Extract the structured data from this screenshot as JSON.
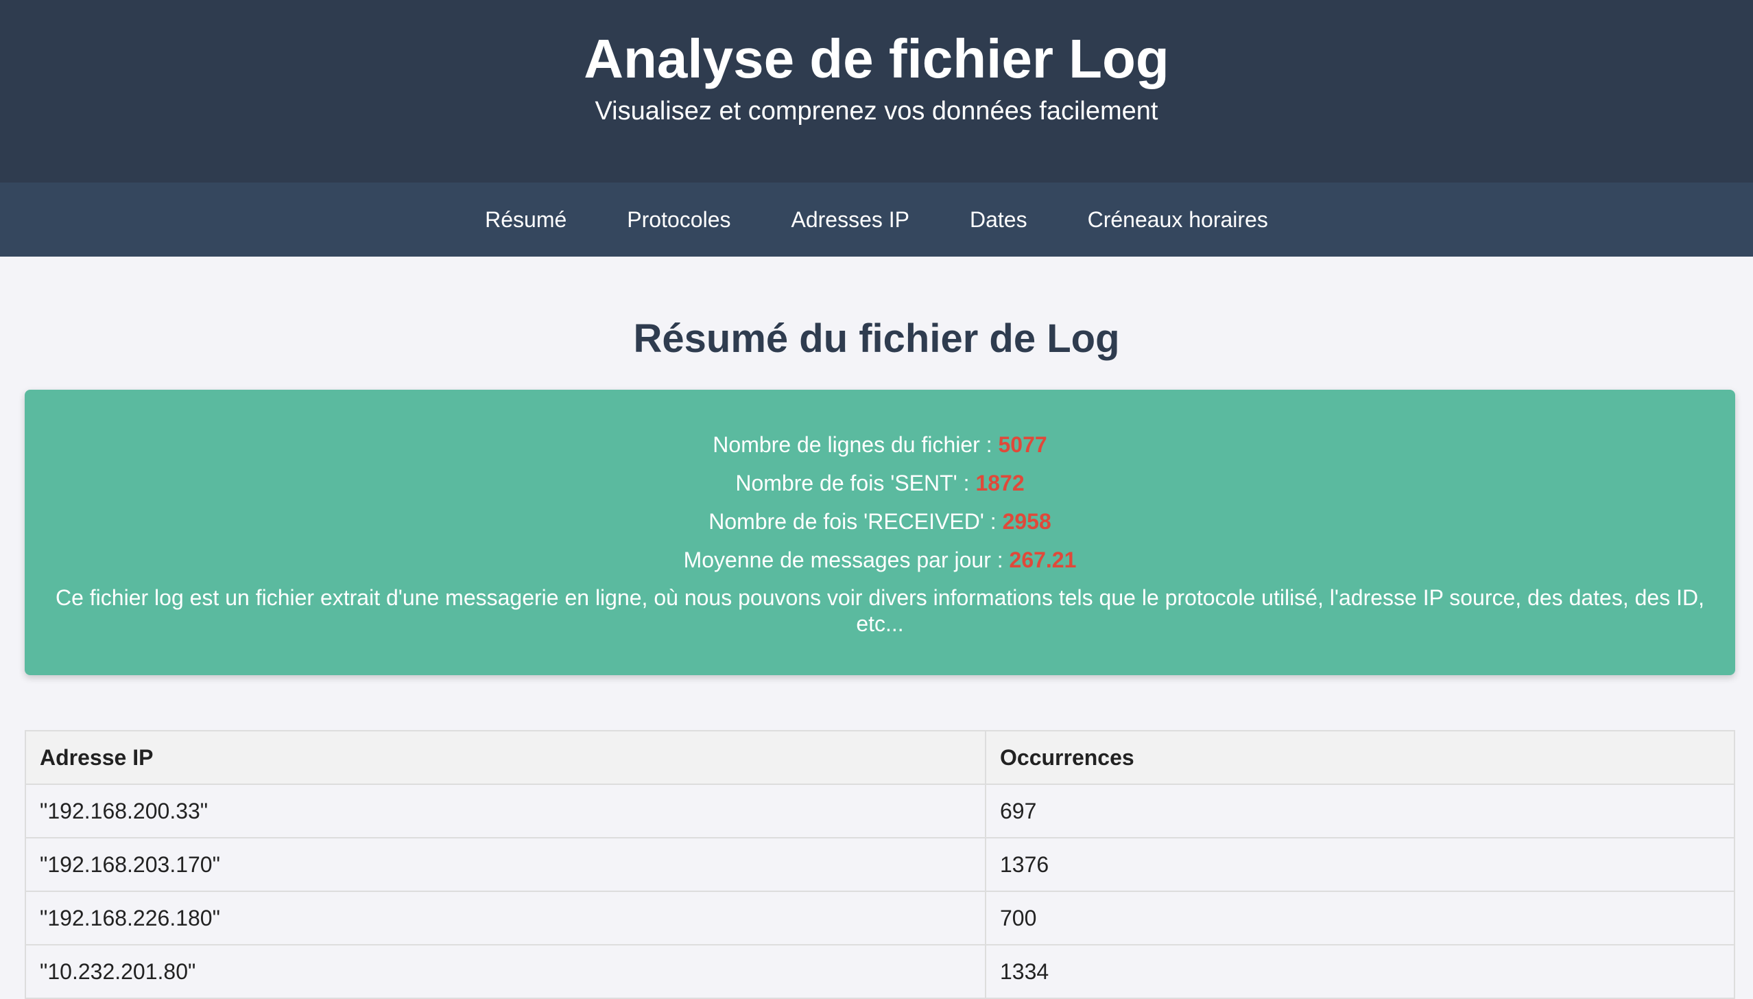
{
  "header": {
    "title": "Analyse de fichier Log",
    "subtitle": "Visualisez et comprenez vos données facilement"
  },
  "nav": {
    "items": [
      "Résumé",
      "Protocoles",
      "Adresses IP",
      "Dates",
      "Créneaux horaires"
    ]
  },
  "summary": {
    "title": "Résumé du fichier de Log",
    "stats": [
      {
        "label": "Nombre de lignes du fichier : ",
        "value": "5077"
      },
      {
        "label": "Nombre de fois 'SENT' : ",
        "value": "1872"
      },
      {
        "label": "Nombre de fois 'RECEIVED' : ",
        "value": "2958"
      },
      {
        "label": "Moyenne de messages par jour : ",
        "value": "267.21"
      }
    ],
    "description": "Ce fichier log est un fichier extrait d'une messagerie en ligne, où nous pouvons voir divers informations tels que le protocole utilisé, l'adresse IP source, des dates, des ID, etc..."
  },
  "ip_table": {
    "headers": [
      "Adresse IP",
      "Occurrences"
    ],
    "rows": [
      [
        "\"192.168.200.33\"",
        "697"
      ],
      [
        "\"192.168.203.170\"",
        "1376"
      ],
      [
        "\"192.168.226.180\"",
        "700"
      ],
      [
        "\"10.232.201.80\"",
        "1334"
      ]
    ]
  },
  "colors": {
    "header_bg": "#2f3c4f",
    "nav_bg": "#35475e",
    "card_bg": "#5bba9f",
    "stat_value": "#e0493a",
    "page_bg": "#f4f4f8"
  }
}
